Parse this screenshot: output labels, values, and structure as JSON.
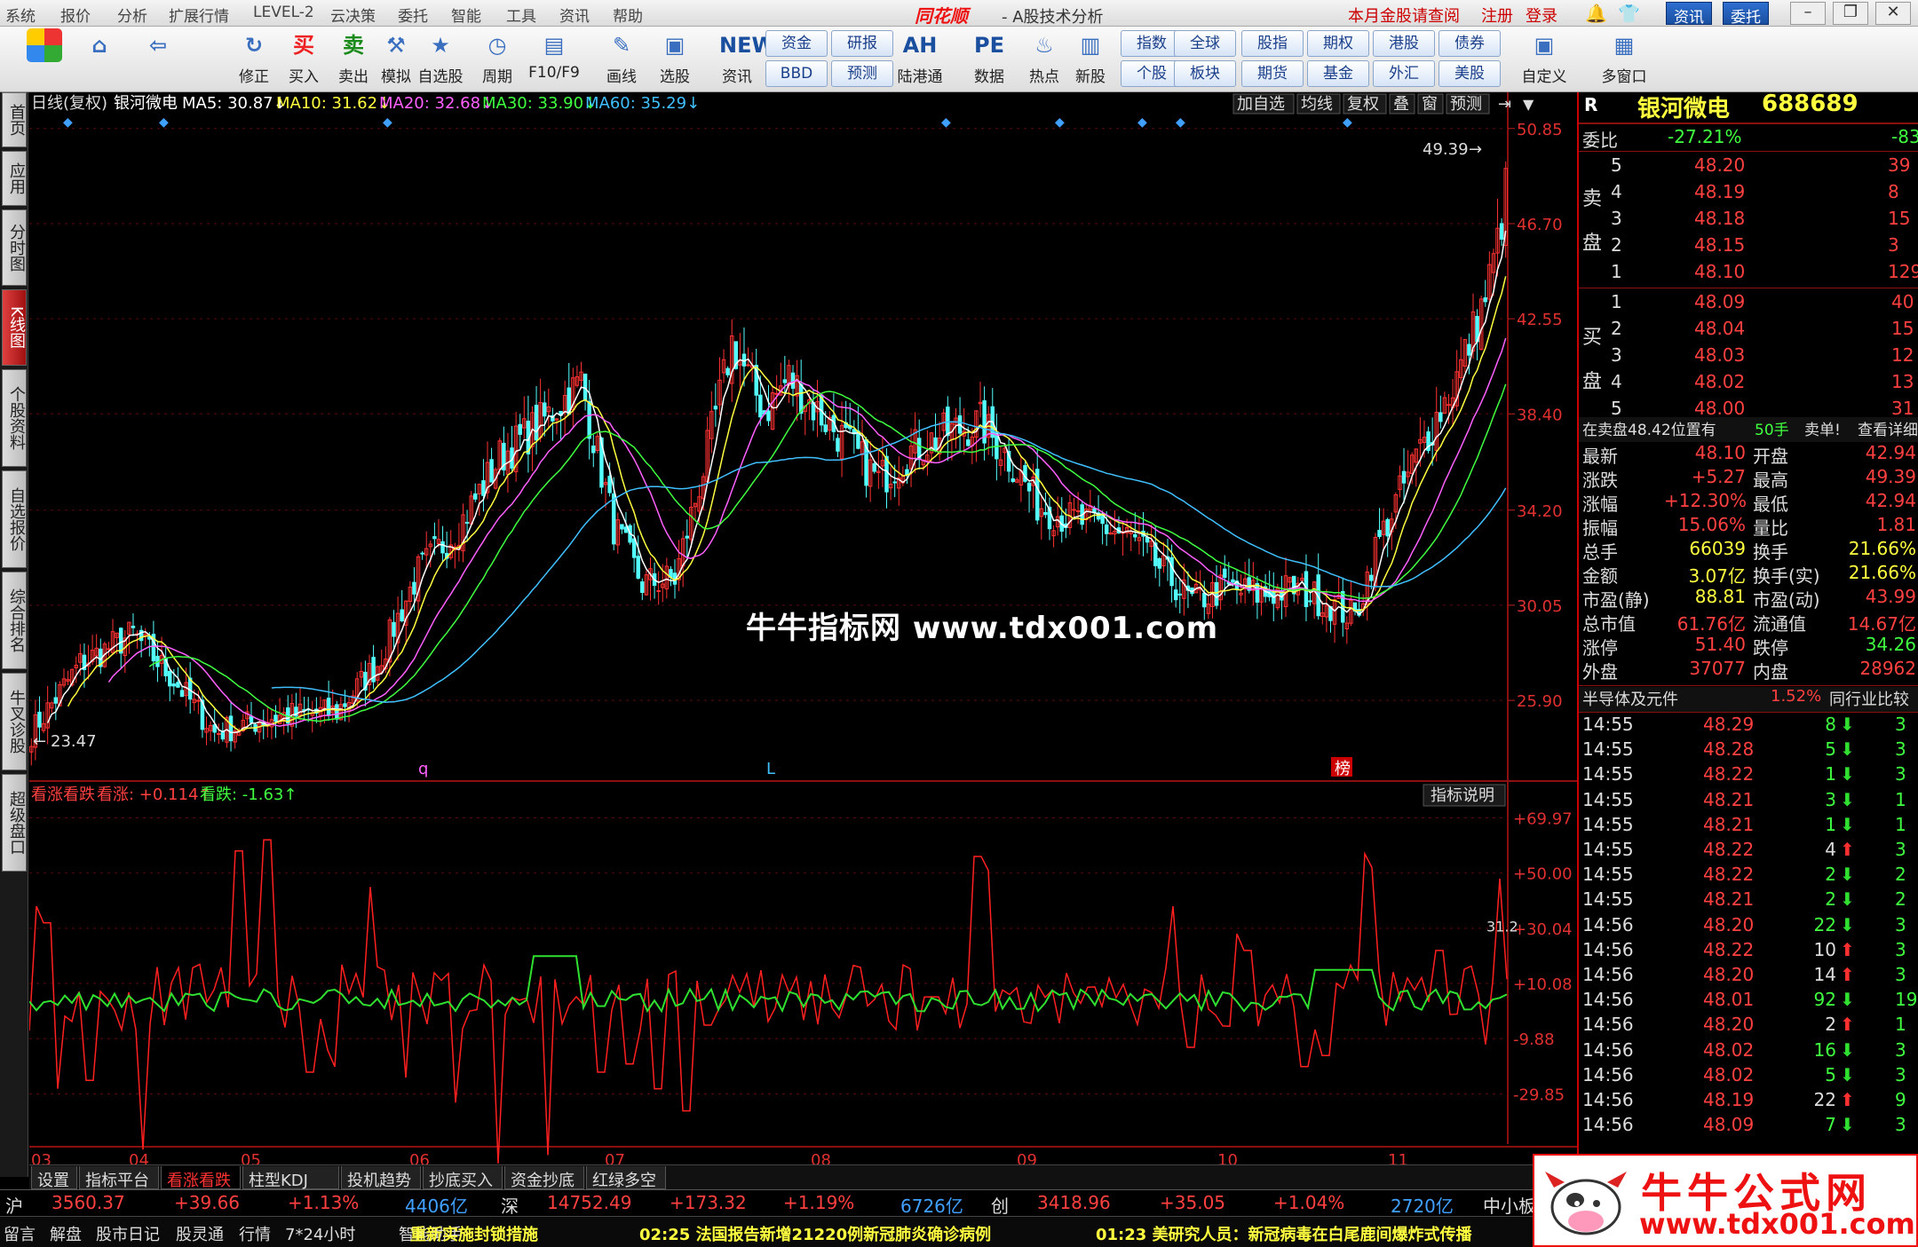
{
  "menu": [
    "系统",
    "报价",
    "分析",
    "扩展行情",
    "LEVEL-2",
    "云决策",
    "委托",
    "智能",
    "工具",
    "资讯",
    "帮助"
  ],
  "brand": "同花顺",
  "apptitle": "- A股技术分析",
  "top_links": [
    "本月金股请查阅",
    "注册",
    "登录"
  ],
  "top_buttons": [
    "资讯",
    "委托"
  ],
  "toolbar": {
    "big": [
      {
        "label": "",
        "icon": "grid-icon"
      },
      {
        "label": "",
        "icon": "home-icon"
      },
      {
        "label": "",
        "icon": "back-arrow-icon"
      },
      {
        "label": "修正",
        "icon": "refresh-icon"
      },
      {
        "label": "买入",
        "icon": "buy-icon",
        "ic": "买"
      },
      {
        "label": "卖出",
        "icon": "sell-icon",
        "ic": "卖"
      },
      {
        "label": "模拟",
        "icon": "hammer-icon"
      },
      {
        "label": "自选股",
        "icon": "star-icon"
      },
      {
        "label": "周期",
        "icon": "clock-icon"
      },
      {
        "label": "F10/F9",
        "icon": "f10-icon"
      },
      {
        "label": "画线",
        "icon": "pen-icon"
      },
      {
        "label": "选股",
        "icon": "screen-icon"
      },
      {
        "label": "资讯",
        "icon": "news-icon",
        "ic": "NEWS"
      },
      {
        "label": "陆港通",
        "icon": "ah-icon",
        "ic": "AH"
      },
      {
        "label": "数据",
        "icon": "pe-icon",
        "ic": "PE"
      },
      {
        "label": "热点",
        "icon": "hot-icon"
      },
      {
        "label": "新股",
        "icon": "newstock-icon"
      }
    ],
    "small": [
      [
        "资金",
        "BBD"
      ],
      [
        "研报",
        "预测"
      ],
      [
        "指数",
        "个股"
      ],
      [
        "全球",
        "板块"
      ],
      [
        "股指",
        "期货"
      ],
      [
        "期权",
        "基金"
      ],
      [
        "港股",
        "外汇"
      ],
      [
        "债券",
        "美股"
      ]
    ],
    "right": [
      "自定义",
      "多窗口"
    ]
  },
  "left_tabs": [
    "首页",
    "应用",
    "分时图",
    "K线图",
    "个股资料",
    "自选报价",
    "综合排名",
    "牛叉诊股",
    "超级盘口"
  ],
  "chart_header": {
    "period": "日线(复权)",
    "name": "银河微电",
    "ma5": "MA5: 30.87↓",
    "ma10": "MA10: 31.62↓",
    "ma20": "MA20: 32.68↓",
    "ma30": "MA30: 33.90↓",
    "ma60": "MA60: 35.29↓"
  },
  "chart_tools": [
    "加自选",
    "均线",
    "复权",
    "叠",
    "窗",
    "预测"
  ],
  "price_axis": [
    "50.85",
    "46.70",
    "42.55",
    "38.40",
    "34.20",
    "30.05",
    "25.90"
  ],
  "ind_axis": [
    "+69.97",
    "+50.00",
    "+30.04",
    "+10.08",
    "-9.88",
    "-29.85"
  ],
  "ind_header": {
    "name": "看涨看跌",
    "up": "看涨: +0.114↑",
    "down": "看跌: -1.63↑"
  },
  "ind_btn": "指标说明",
  "ind_last": "31.2",
  "hi_label": "49.39",
  "lo_label": "23.47",
  "markers": [
    "q",
    "L",
    "榜"
  ],
  "months": [
    "03",
    "04",
    "05",
    "06",
    "07",
    "08",
    "09",
    "10",
    "11"
  ],
  "bottom_tabs": [
    "设置",
    "指标平台",
    "看涨看跌",
    "柱型KDJ",
    "投机趋势",
    "抄底买入",
    "资金抄底",
    "红绿多空"
  ],
  "quote": {
    "flag": "R",
    "name": "银河微电",
    "code": "688689",
    "weibi_label": "委比",
    "weibi": "-27.21%",
    "weicha": "-83",
    "sell_label": "卖盘",
    "buy_label": "买盘",
    "sells": [
      [
        "5",
        "48.20",
        "39"
      ],
      [
        "4",
        "48.19",
        "8"
      ],
      [
        "3",
        "48.18",
        "15"
      ],
      [
        "2",
        "48.15",
        "3"
      ],
      [
        "1",
        "48.10",
        "129"
      ]
    ],
    "buys": [
      [
        "1",
        "48.09",
        "40"
      ],
      [
        "2",
        "48.04",
        "15"
      ],
      [
        "3",
        "48.03",
        "12"
      ],
      [
        "4",
        "48.02",
        "13"
      ],
      [
        "5",
        "48.00",
        "31"
      ]
    ],
    "notice": "在卖盘48.42位置有",
    "notice_vol": "50手",
    "notice_type": "卖单!",
    "notice_link": "查看详细",
    "stats": [
      [
        "最新",
        "48.10",
        "开盘",
        "42.94"
      ],
      [
        "涨跌",
        "+5.27",
        "最高",
        "49.39"
      ],
      [
        "涨幅",
        "+12.30%",
        "最低",
        "42.94"
      ],
      [
        "振幅",
        "15.06%",
        "量比",
        "1.81"
      ],
      [
        "总手",
        "66039",
        "换手",
        "21.66%"
      ],
      [
        "金额",
        "3.07亿",
        "换手(实)",
        "21.66%"
      ],
      [
        "市盈(静)",
        "88.81",
        "市盈(动)",
        "43.99"
      ],
      [
        "总市值",
        "61.76亿",
        "流通值",
        "14.67亿"
      ],
      [
        "涨停",
        "51.40",
        "跌停",
        "34.26"
      ],
      [
        "外盘",
        "37077",
        "内盘",
        "28962"
      ]
    ],
    "sector": "半导体及元件",
    "sector_pct": "1.52%",
    "sector_btn": "同行业比较",
    "ticks": [
      [
        "14:55",
        "48.29",
        "8",
        "d",
        "3"
      ],
      [
        "14:55",
        "48.28",
        "5",
        "d",
        "3"
      ],
      [
        "14:55",
        "48.22",
        "1",
        "d",
        "3"
      ],
      [
        "14:55",
        "48.21",
        "3",
        "d",
        "1"
      ],
      [
        "14:55",
        "48.21",
        "1",
        "d",
        "1"
      ],
      [
        "14:55",
        "48.22",
        "4",
        "u",
        "3"
      ],
      [
        "14:55",
        "48.22",
        "2",
        "d",
        "2"
      ],
      [
        "14:55",
        "48.21",
        "2",
        "d",
        "2"
      ],
      [
        "14:56",
        "48.20",
        "22",
        "d",
        "3"
      ],
      [
        "14:56",
        "48.22",
        "10",
        "u",
        "3"
      ],
      [
        "14:56",
        "48.20",
        "14",
        "u",
        "3"
      ],
      [
        "14:56",
        "48.01",
        "92",
        "d",
        "19"
      ],
      [
        "14:56",
        "48.20",
        "2",
        "u",
        "1"
      ],
      [
        "14:56",
        "48.02",
        "16",
        "d",
        "3"
      ],
      [
        "14:56",
        "48.02",
        "5",
        "d",
        "3"
      ],
      [
        "14:56",
        "48.19",
        "22",
        "u",
        "9"
      ],
      [
        "14:56",
        "48.09",
        "7",
        "d",
        "3"
      ]
    ]
  },
  "indices": {
    "sh": [
      "沪",
      "3560.37",
      "+39.66",
      "+1.13%",
      "4406亿"
    ],
    "sz": [
      "深",
      "14752.49",
      "+173.32",
      "+1.19%",
      "6726亿"
    ],
    "cy": [
      "创",
      "3418.96",
      "+35.05",
      "+1.04%",
      "2720亿"
    ],
    "tail": "中小板"
  },
  "news": {
    "items": [
      "留言",
      "解盘",
      "股市日记",
      "股灵通",
      "行情",
      "7*24小时",
      "智能助手"
    ],
    "n1": "重新实施封锁措施",
    "n2": "02:25 法国报告新增21220例新冠肺炎确诊病例",
    "n3": "01:23 美研究人员：新冠病毒在白尾鹿间爆炸式传播"
  },
  "watermark": "牛牛指标网 www.tdx001.com",
  "logo": {
    "t1": "牛牛公式网",
    "t2": "www.tdx001.com"
  },
  "colors": {
    "up": "#ff3232",
    "down": "#54ffff",
    "ma5": "#ffffff",
    "ma10": "#ffff40",
    "ma20": "#ff60ff",
    "ma30": "#40ff40",
    "ma60": "#40c0ff"
  }
}
